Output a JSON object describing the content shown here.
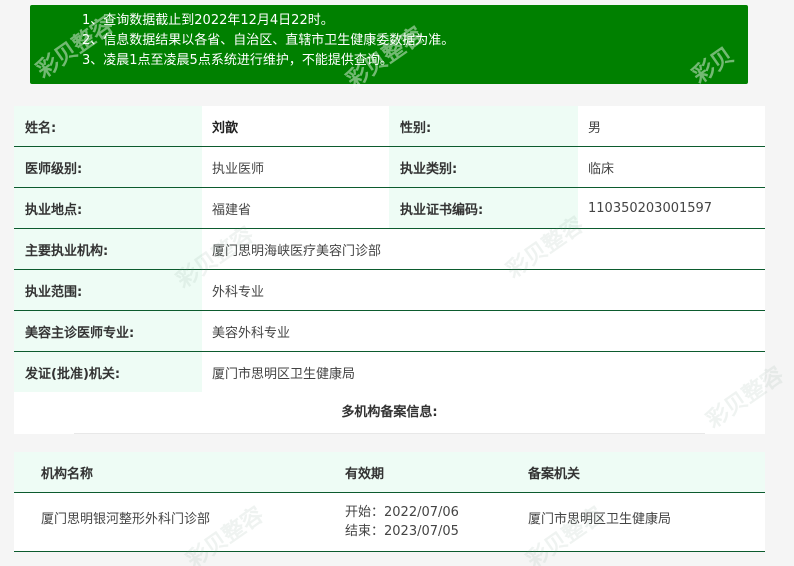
{
  "notice": {
    "lines": [
      "1、查询数据截止到2022年12月4日22时。",
      "2、信息数据结果以各省、自治区、直辖市卫生健康委数据为准。",
      "3、凌晨1点至凌晨5点系统进行维护，不能提供查询。"
    ]
  },
  "colors": {
    "notice_bg": "#008000",
    "label_bg": "#eefcf5",
    "row_border": "#0c5b2e"
  },
  "info": {
    "name_label": "姓名:",
    "name_value": "刘歆",
    "gender_label": "性别:",
    "gender_value": "男",
    "level_label": "医师级别:",
    "level_value": "执业医师",
    "category_label": "执业类别:",
    "category_value": "临床",
    "location_label": "执业地点:",
    "location_value": "福建省",
    "cert_label": "执业证书编码:",
    "cert_value": "110350203001597",
    "institution_label": "主要执业机构:",
    "institution_value": "厦门思明海峡医疗美容门诊部",
    "scope_label": "执业范围:",
    "scope_value": "外科专业",
    "beauty_label": "美容主诊医师专业:",
    "beauty_value": "美容外科专业",
    "authority_label": "发证(批准)机关:",
    "authority_value": "厦门市思明区卫生健康局"
  },
  "multi": {
    "title": "多机构备案信息:",
    "headers": {
      "name": "机构名称",
      "validity": "有效期",
      "authority": "备案机关"
    },
    "rows": [
      {
        "name": "厦门思明银河整形外科门诊部",
        "start": "开始：2022/07/06",
        "end": "结束：2023/07/05",
        "authority": "厦门市思明区卫生健康局"
      }
    ]
  },
  "watermark": {
    "text": "彩贝整容"
  }
}
